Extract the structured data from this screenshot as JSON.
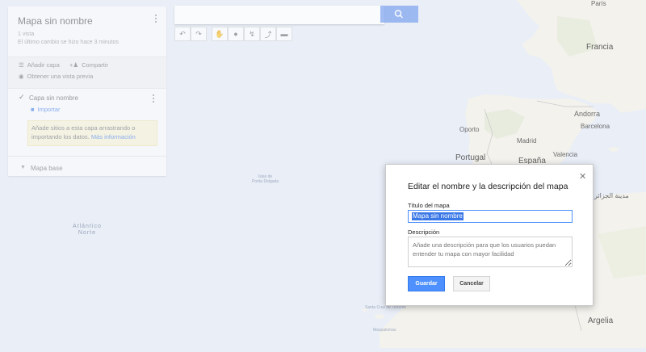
{
  "panel": {
    "map_title": "Mapa sin nombre",
    "views": "1 vista",
    "last_change": "El último cambio se hizo hace 3 minutos",
    "add_layer": "Añadir capa",
    "share": "Compartir",
    "preview": "Obtener una vista previa",
    "layer_name": "Capa sin nombre",
    "import": "Importar",
    "hint_text": "Añade sitios a esta capa arrastrando o importando los datos.",
    "hint_link": "Más información",
    "base_map": "Mapa base"
  },
  "search": {
    "placeholder": ""
  },
  "toolbar": {
    "icons": [
      "undo-icon",
      "redo-icon",
      "hand-icon",
      "marker-icon",
      "line-icon",
      "directions-icon",
      "ruler-icon"
    ]
  },
  "map_labels": {
    "france": "Francia",
    "paris": "París",
    "andorra": "Andorra",
    "barcelona": "Barcelona",
    "oporto": "Oporto",
    "madrid": "Madrid",
    "portugal": "Portugal",
    "spain": "España",
    "valencia": "Valencia",
    "ocean": "Atlántico Norte",
    "ocean_line1": "Atlántico",
    "ocean_line2": "Norte",
    "island1_line1": "Islas de",
    "island1_line2": "Ponta Delgada",
    "algeria": "Argelia",
    "santa_cruz": "Santa Cruz de Tenerife",
    "maspalomas": "Maspalomas",
    "arabic_city": "مدينة الجزائر"
  },
  "dialog": {
    "title": "Editar el nombre y la descripción del mapa",
    "map_title_label": "Título del mapa",
    "map_title_value": "Mapa sin nombre",
    "description_label": "Descripción",
    "description_placeholder": "Añade una descripción para que los usuarios puedan entender tu mapa con mayor facilidad",
    "save_label": "Guardar",
    "cancel_label": "Cancelar"
  },
  "colors": {
    "ocean": "#e9eef7",
    "land": "#f2f1ec",
    "accent": "#4d90fe",
    "link": "#3b78e7"
  }
}
